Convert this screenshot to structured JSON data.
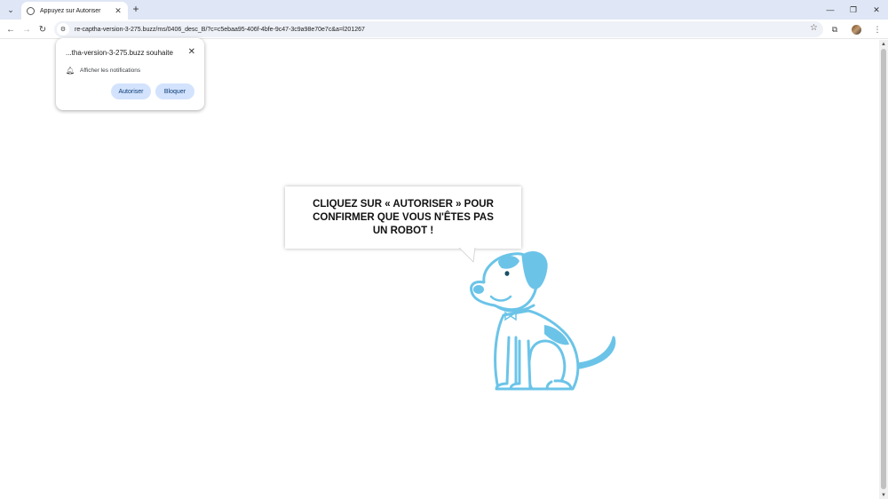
{
  "tab": {
    "title": "Appuyez sur Autoriser"
  },
  "address_bar": {
    "url": "re-captha-version-3-275.buzz/ms/0406_desc_B/?c=c5ebaa95-406f-4bfe-9c47-3c9a98e70e7c&a=l201267"
  },
  "notification_prompt": {
    "title": "...tha-version-3-275.buzz souhaite",
    "permission_text": "Afficher les notifications",
    "allow_label": "Autoriser",
    "block_label": "Bloquer"
  },
  "page": {
    "message": "CLIQUEZ SUR « AUTORISER » POUR CONFIRMER QUE VOUS N'ÊTES PAS UN ROBOT !"
  },
  "colors": {
    "dog_blue": "#6bc4e8",
    "button_bg": "#d3e3fd",
    "tabstrip_bg": "#dfe6f5"
  },
  "icons": [
    "tab-search-icon",
    "globe-icon",
    "close-icon",
    "plus-icon",
    "minimize-icon",
    "restore-icon",
    "back-arrow-icon",
    "forward-arrow-icon",
    "reload-icon",
    "site-info-icon",
    "star-icon",
    "extensions-icon",
    "profile-avatar",
    "kebab-menu-icon",
    "bell-icon"
  ]
}
